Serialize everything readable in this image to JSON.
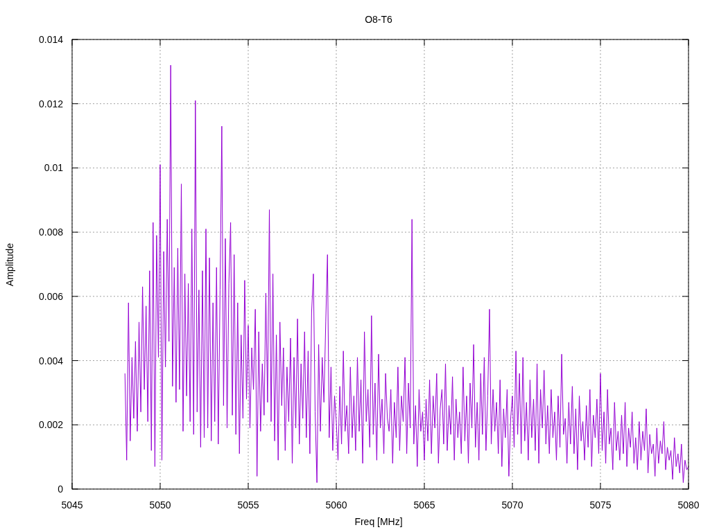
{
  "chart": {
    "chart_data": {
      "type": "line",
      "title": "O8-T6",
      "xlabel": "Freq [MHz]",
      "ylabel": "Amplitude",
      "xlim": [
        5045,
        5080
      ],
      "ylim": [
        0,
        0.014
      ],
      "grid": true,
      "xticks": [
        5045,
        5050,
        5055,
        5060,
        5065,
        5070,
        5075,
        5080
      ],
      "yticks": [
        0,
        0.002,
        0.004,
        0.006,
        0.008,
        0.01,
        0.012,
        0.014
      ],
      "x": [
        5048,
        5048.1,
        5048.2,
        5048.3,
        5048.4,
        5048.5,
        5048.6,
        5048.7,
        5048.8,
        5048.9,
        5049,
        5049.1,
        5049.2,
        5049.3,
        5049.4,
        5049.5,
        5049.6,
        5049.7,
        5049.8,
        5049.9,
        5050,
        5050.1,
        5050.2,
        5050.3,
        5050.4,
        5050.5,
        5050.6,
        5050.7,
        5050.8,
        5050.9,
        5051,
        5051.1,
        5051.2,
        5051.3,
        5051.4,
        5051.5,
        5051.6,
        5051.7,
        5051.8,
        5051.9,
        5052,
        5052.1,
        5052.2,
        5052.3,
        5052.4,
        5052.5,
        5052.6,
        5052.7,
        5052.8,
        5052.9,
        5053,
        5053.1,
        5053.2,
        5053.3,
        5053.4,
        5053.5,
        5053.6,
        5053.7,
        5053.8,
        5053.9,
        5054,
        5054.1,
        5054.2,
        5054.3,
        5054.4,
        5054.5,
        5054.6,
        5054.7,
        5054.8,
        5054.9,
        5055,
        5055.1,
        5055.2,
        5055.3,
        5055.4,
        5055.5,
        5055.6,
        5055.7,
        5055.8,
        5055.9,
        5056,
        5056.1,
        5056.2,
        5056.3,
        5056.4,
        5056.5,
        5056.6,
        5056.7,
        5056.8,
        5056.9,
        5057,
        5057.1,
        5057.2,
        5057.3,
        5057.4,
        5057.5,
        5057.6,
        5057.7,
        5057.8,
        5057.9,
        5058,
        5058.1,
        5058.2,
        5058.3,
        5058.4,
        5058.5,
        5058.6,
        5058.7,
        5058.8,
        5058.9,
        5059,
        5059.1,
        5059.2,
        5059.3,
        5059.4,
        5059.5,
        5059.6,
        5059.7,
        5059.8,
        5059.9,
        5060,
        5060.1,
        5060.2,
        5060.3,
        5060.4,
        5060.5,
        5060.6,
        5060.7,
        5060.8,
        5060.9,
        5061,
        5061.1,
        5061.2,
        5061.3,
        5061.4,
        5061.5,
        5061.6,
        5061.7,
        5061.8,
        5061.9,
        5062,
        5062.1,
        5062.2,
        5062.3,
        5062.4,
        5062.5,
        5062.6,
        5062.7,
        5062.8,
        5062.9,
        5063,
        5063.1,
        5063.2,
        5063.3,
        5063.4,
        5063.5,
        5063.6,
        5063.7,
        5063.8,
        5063.9,
        5064,
        5064.1,
        5064.2,
        5064.3,
        5064.4,
        5064.5,
        5064.6,
        5064.7,
        5064.8,
        5064.9,
        5065,
        5065.1,
        5065.2,
        5065.3,
        5065.4,
        5065.5,
        5065.6,
        5065.7,
        5065.8,
        5065.9,
        5066,
        5066.1,
        5066.2,
        5066.3,
        5066.4,
        5066.5,
        5066.6,
        5066.7,
        5066.8,
        5066.9,
        5067,
        5067.1,
        5067.2,
        5067.3,
        5067.4,
        5067.5,
        5067.6,
        5067.7,
        5067.8,
        5067.9,
        5068,
        5068.1,
        5068.2,
        5068.3,
        5068.4,
        5068.5,
        5068.6,
        5068.7,
        5068.8,
        5068.9,
        5069,
        5069.1,
        5069.2,
        5069.3,
        5069.4,
        5069.5,
        5069.6,
        5069.7,
        5069.8,
        5069.9,
        5070,
        5070.1,
        5070.2,
        5070.3,
        5070.4,
        5070.5,
        5070.6,
        5070.7,
        5070.8,
        5070.9,
        5071,
        5071.1,
        5071.2,
        5071.3,
        5071.4,
        5071.5,
        5071.6,
        5071.7,
        5071.8,
        5071.9,
        5072,
        5072.1,
        5072.2,
        5072.3,
        5072.4,
        5072.5,
        5072.6,
        5072.7,
        5072.8,
        5072.9,
        5073,
        5073.1,
        5073.2,
        5073.3,
        5073.4,
        5073.5,
        5073.6,
        5073.7,
        5073.8,
        5073.9,
        5074,
        5074.1,
        5074.2,
        5074.3,
        5074.4,
        5074.5,
        5074.6,
        5074.7,
        5074.8,
        5074.9,
        5075,
        5075.1,
        5075.2,
        5075.3,
        5075.4,
        5075.5,
        5075.6,
        5075.7,
        5075.8,
        5075.9,
        5076,
        5076.1,
        5076.2,
        5076.3,
        5076.4,
        5076.5,
        5076.6,
        5076.7,
        5076.8,
        5076.9,
        5077,
        5077.1,
        5077.2,
        5077.3,
        5077.4,
        5077.5,
        5077.6,
        5077.7,
        5077.8,
        5077.9,
        5078,
        5078.1,
        5078.2,
        5078.3,
        5078.4,
        5078.5,
        5078.6,
        5078.7,
        5078.8,
        5078.9,
        5079,
        5079.1,
        5079.2,
        5079.3,
        5079.4,
        5079.5,
        5079.6,
        5079.7,
        5079.8,
        5079.9,
        5080
      ],
      "series": [
        {
          "color": "#9400d3",
          "values": [
            0.0036,
            0.0009,
            0.0058,
            0.0015,
            0.0041,
            0.0022,
            0.0046,
            0.0018,
            0.0052,
            0.0024,
            0.0063,
            0.0031,
            0.0057,
            0.0021,
            0.0068,
            0.0012,
            0.0083,
            0.0007,
            0.0079,
            0.0041,
            0.0101,
            0.0009,
            0.0074,
            0.0038,
            0.0084,
            0.0046,
            0.0132,
            0.0032,
            0.0069,
            0.0027,
            0.0075,
            0.0031,
            0.0095,
            0.0018,
            0.0067,
            0.0029,
            0.0064,
            0.0021,
            0.0081,
            0.0017,
            0.0121,
            0.0024,
            0.0062,
            0.0013,
            0.0068,
            0.0016,
            0.0081,
            0.0019,
            0.0072,
            0.0015,
            0.0058,
            0.0021,
            0.0069,
            0.0014,
            0.0062,
            0.0113,
            0.0026,
            0.0078,
            0.0019,
            0.0064,
            0.0083,
            0.0023,
            0.0073,
            0.0017,
            0.0058,
            0.0011,
            0.0048,
            0.0022,
            0.0065,
            0.0028,
            0.0051,
            0.0019,
            0.0044,
            0.0031,
            0.0056,
            0.0004,
            0.0049,
            0.0018,
            0.0039,
            0.0023,
            0.0061,
            0.0027,
            0.0087,
            0.0021,
            0.0067,
            0.0015,
            0.0048,
            0.0009,
            0.0052,
            0.0026,
            0.0044,
            0.0012,
            0.0038,
            0.0021,
            0.0047,
            0.0008,
            0.0041,
            0.0019,
            0.0053,
            0.0014,
            0.0039,
            0.0022,
            0.0049,
            0.0016,
            0.0043,
            0.0011,
            0.0055,
            0.0067,
            0.0024,
            0.0002,
            0.0045,
            0.0018,
            0.0041,
            0.0027,
            0.0052,
            0.0073,
            0.0016,
            0.0038,
            0.0012,
            0.0029,
            0.0021,
            0.0009,
            0.0032,
            0.0014,
            0.0043,
            0.0018,
            0.0026,
            0.0011,
            0.0038,
            0.0016,
            0.0029,
            0.0012,
            0.0041,
            0.0018,
            0.0034,
            0.0008,
            0.0049,
            0.0021,
            0.0031,
            0.0013,
            0.0054,
            0.0017,
            0.0033,
            0.0009,
            0.0042,
            0.0019,
            0.0028,
            0.0011,
            0.0036,
            0.0022,
            0.0018,
            0.0031,
            0.0008,
            0.0027,
            0.0016,
            0.0038,
            0.0012,
            0.0029,
            0.0021,
            0.0041,
            0.0011,
            0.0033,
            0.0019,
            0.0084,
            0.0014,
            0.0026,
            0.0007,
            0.0031,
            0.0018,
            0.0024,
            0.0009,
            0.0028,
            0.0015,
            0.0034,
            0.0011,
            0.0029,
            0.0019,
            0.0036,
            0.0008,
            0.0025,
            0.0031,
            0.0014,
            0.0039,
            0.0012,
            0.0026,
            0.0017,
            0.0035,
            0.0009,
            0.0028,
            0.0016,
            0.0024,
            0.0011,
            0.0038,
            0.0015,
            0.0029,
            0.0008,
            0.0033,
            0.0019,
            0.0045,
            0.0013,
            0.0027,
            0.0009,
            0.0036,
            0.0017,
            0.0041,
            0.0012,
            0.0029,
            0.0056,
            0.0014,
            0.0031,
            0.0018,
            0.0027,
            0.0011,
            0.0034,
            0.0007,
            0.0025,
            0.0016,
            0.0031,
            0.0004,
            0.0022,
            0.0029,
            0.0013,
            0.0043,
            0.0017,
            0.0036,
            0.0011,
            0.0041,
            0.0015,
            0.0027,
            0.0009,
            0.0034,
            0.0016,
            0.0028,
            0.0012,
            0.0039,
            0.0008,
            0.0031,
            0.0019,
            0.0037,
            0.0014,
            0.0026,
            0.0011,
            0.0031,
            0.0016,
            0.0024,
            0.0009,
            0.0029,
            0.0013,
            0.0042,
            0.0017,
            0.0022,
            0.0008,
            0.0027,
            0.0014,
            0.0032,
            0.0011,
            0.0025,
            0.0006,
            0.0029,
            0.0015,
            0.0021,
            0.0009,
            0.0026,
            0.0013,
            0.0031,
            0.0007,
            0.0023,
            0.0016,
            0.0028,
            0.0011,
            0.0036,
            0.0012,
            0.0024,
            0.0008,
            0.0031,
            0.0014,
            0.0019,
            0.0006,
            0.0027,
            0.0012,
            0.0018,
            0.0009,
            0.0023,
            0.0011,
            0.0027,
            0.0007,
            0.0019,
            0.0013,
            0.0024,
            0.0008,
            0.0016,
            0.0006,
            0.0021,
            0.0009,
            0.0018,
            0.0012,
            0.0025,
            0.0005,
            0.0017,
            0.0011,
            0.0014,
            0.0004,
            0.0019,
            0.0008,
            0.0015,
            0.0011,
            0.0021,
            0.0006,
            0.0013,
            0.0009,
            0.0012,
            0.0003,
            0.0016,
            0.0007,
            0.0011,
            0.0005,
            0.0014,
            0.0002,
            0.0009,
            0.0006,
            0.0007
          ]
        }
      ]
    }
  }
}
